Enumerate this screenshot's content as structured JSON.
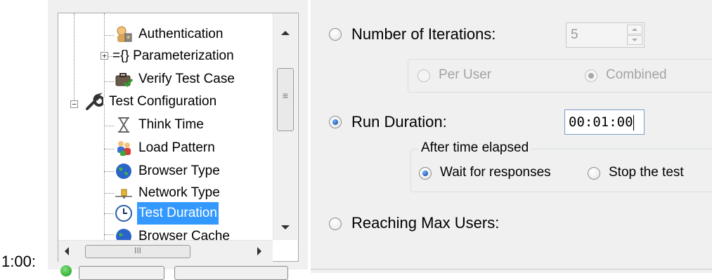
{
  "tree": {
    "items": [
      {
        "label": "Authentication",
        "icon": "authentication-icon"
      },
      {
        "label": "={} Parameterization",
        "icon": "expand-icon"
      },
      {
        "label": "Verify Test Case",
        "icon": "verify-test-case-icon"
      },
      {
        "label": "Test Configuration",
        "icon": "wrench-icon"
      },
      {
        "label": "Think Time",
        "icon": "hourglass-icon"
      },
      {
        "label": "Load Pattern",
        "icon": "users-icon"
      },
      {
        "label": "Browser Type",
        "icon": "globe-icon"
      },
      {
        "label": "Network Type",
        "icon": "network-icon"
      },
      {
        "label": "Test Duration",
        "icon": "clock-icon",
        "selected": true
      },
      {
        "label": "Browser Cache",
        "icon": "browser-cache-icon"
      }
    ],
    "scroll_grip": "≡",
    "hscroll_grip": "III"
  },
  "options": {
    "iterations": {
      "label": "Number of Iterations:",
      "value": "5",
      "selected": false
    },
    "iteration_scope": {
      "per_user": {
        "label": "Per User",
        "selected": false
      },
      "combined": {
        "label": "Combined",
        "selected": true
      }
    },
    "run_duration": {
      "label": "Run Duration:",
      "value": "00:01:00",
      "selected": true
    },
    "after_time_elapsed": {
      "title": "After time elapsed",
      "wait": {
        "label": "Wait for responses",
        "selected": true
      },
      "stop": {
        "label": "Stop the test",
        "selected": false
      }
    },
    "max_users": {
      "label": "Reaching Max Users:",
      "selected": false
    }
  },
  "bottom": {
    "partial_text": "1:00:"
  },
  "colors": {
    "selection": "#3399ff",
    "panel": "#f0f0f0",
    "status": "#1a9a1a"
  }
}
